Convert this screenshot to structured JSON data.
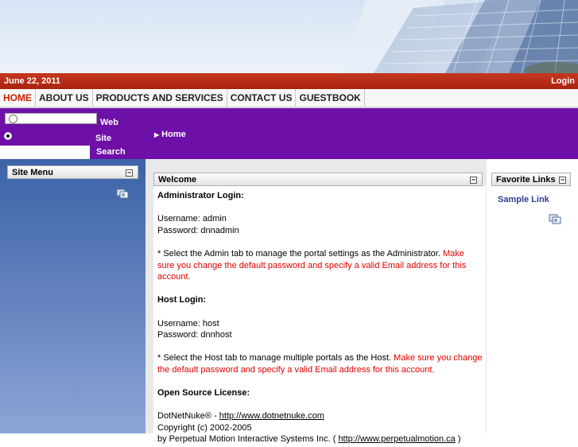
{
  "header": {
    "date": "June 22, 2011",
    "login_label": "Login"
  },
  "nav": {
    "items": [
      "HOME",
      "ABOUT US",
      "PRODUCTS AND SERVICES",
      "CONTACT US",
      "GUESTBOOK"
    ],
    "active": "HOME"
  },
  "search": {
    "option_web": "Web",
    "option_site": "Site",
    "selected": "Site",
    "button_label": "Search"
  },
  "breadcrumb": {
    "label": "Home"
  },
  "left_panel": {
    "title": "Site Menu"
  },
  "welcome": {
    "title": "Welcome",
    "admin_heading": "Administrator Login:",
    "admin_username": "Username: admin",
    "admin_password": "Password: dnnadmin",
    "admin_note": "* Select the Admin tab to manage the portal settings as the Administrator.",
    "admin_warning": "Make sure you change the default password and specify a valid Email address for this account.",
    "host_heading": "Host Login:",
    "host_username": "Username: host",
    "host_password": "Password: dnnhost",
    "host_note": "* Select the Host tab to manage multiple portals as the Host.",
    "host_warning": "Make sure you change the default password and specify a valid Email address for this account.",
    "license_heading": "Open Source License:",
    "license_product": "DotNetNuke® - ",
    "license_link": "http://www.dotnetnuke.com",
    "copyright": "Copyright (c) 2002-2005",
    "by_text": "by Perpetual Motion Interactive Systems Inc. ( ",
    "by_link": "http://www.perpetualmotion.ca",
    "by_close": " )"
  },
  "favorites": {
    "title": "Favorite Links",
    "link": "Sample Link"
  },
  "colors": {
    "red_bar": "#b52a14",
    "purple_bar": "#6e0fa8",
    "active_nav": "#cc2200",
    "warning_text": "#e00000",
    "link_blue": "#2c3e8c"
  }
}
